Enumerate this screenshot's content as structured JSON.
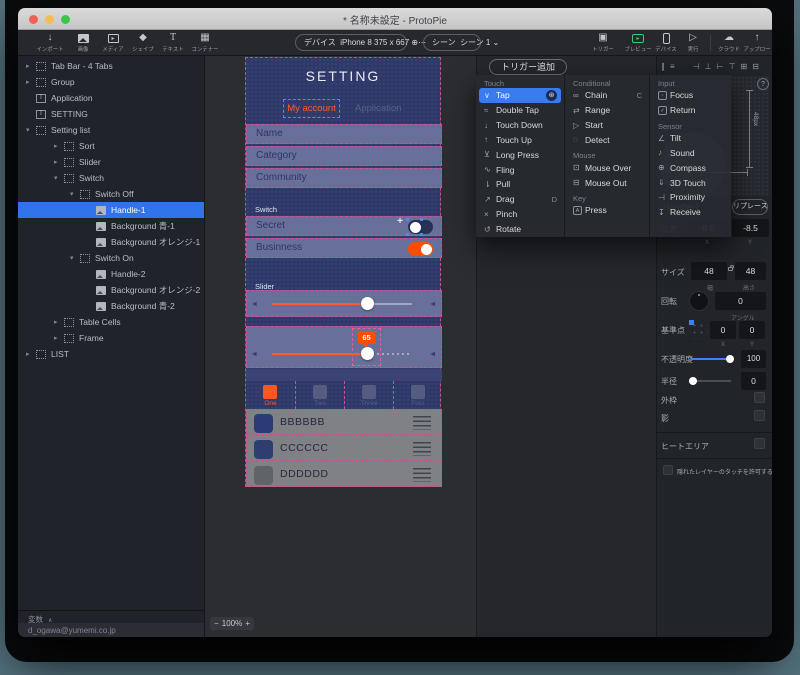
{
  "window": {
    "title": "* 名称未設定 - ProtoPie"
  },
  "toolbar": {
    "import": {
      "label": "インポート"
    },
    "insert_tools": [
      {
        "label": "画像"
      },
      {
        "label": "メディア"
      },
      {
        "label": "シェイプ"
      },
      {
        "label": "テキスト"
      },
      {
        "label": "コンテナー"
      }
    ],
    "device_selector": {
      "prefix": "デバイス",
      "value": "iPhone 8  375 x 667  ⊕⋯"
    },
    "scene_selector": {
      "prefix": "シーン",
      "value": "シーン 1  ⌄"
    },
    "right_tools": [
      {
        "label": "トリガー"
      },
      {
        "label": "プレビュー"
      },
      {
        "label": "デバイス"
      },
      {
        "label": "実行"
      },
      {
        "label": "クラウド"
      },
      {
        "label": "アップロード"
      }
    ]
  },
  "sidebar": {
    "layers": [
      {
        "label": "Tab Bar - 4 Tabs"
      },
      {
        "label": "Group"
      },
      {
        "label": "Application"
      },
      {
        "label": "SETTING"
      },
      {
        "label": "Setting list"
      },
      {
        "label": "Sort"
      },
      {
        "label": "Slider"
      },
      {
        "label": "Switch"
      },
      {
        "label": "Switch Off"
      },
      {
        "label": "Handle-1"
      },
      {
        "label": "Background 青-1"
      },
      {
        "label": "Background オレンジ-1"
      },
      {
        "label": "Switch On"
      },
      {
        "label": "Handle-2"
      },
      {
        "label": "Background オレンジ-2"
      },
      {
        "label": "Background 青-2"
      },
      {
        "label": "Table Cells"
      },
      {
        "label": "Frame"
      },
      {
        "label": "LIST"
      }
    ],
    "variables_label": "変数",
    "account_email": "d_ogawa@yumemi.co.jp"
  },
  "canvas": {
    "zoom_out": "−",
    "zoom_level": "100%",
    "zoom_in": "+"
  },
  "phone": {
    "title": "SETTING",
    "tabs": [
      {
        "label": "My account"
      },
      {
        "label": "Application"
      }
    ],
    "fields": [
      {
        "label": "Name"
      },
      {
        "label": "Category"
      },
      {
        "label": "Community"
      }
    ],
    "switch_section_label": "Switch",
    "switches": [
      {
        "label": "Secret",
        "state": "off"
      },
      {
        "label": "Businness",
        "state": "on"
      }
    ],
    "slider_section_label": "Slider",
    "slider_value": "65",
    "tabbar": [
      {
        "label": "One"
      },
      {
        "label": "Two"
      },
      {
        "label": "Three"
      },
      {
        "label": "Four"
      }
    ],
    "list": [
      {
        "label": "BBBBBB"
      },
      {
        "label": "CCCCCC"
      },
      {
        "label": "DDDDDD"
      }
    ]
  },
  "trigger_panel": {
    "add_button": "トリガー追加"
  },
  "trigger_menu": {
    "touch": {
      "header": "Touch",
      "items": [
        {
          "label": "Tap",
          "selected": true
        },
        {
          "label": "Double Tap"
        },
        {
          "label": "Touch Down"
        },
        {
          "label": "Touch Up"
        },
        {
          "label": "Long Press"
        },
        {
          "label": "Fling"
        },
        {
          "label": "Pull"
        },
        {
          "label": "Drag",
          "shortcut": "D"
        },
        {
          "label": "Pinch"
        },
        {
          "label": "Rotate"
        }
      ]
    },
    "conditional": {
      "header": "Conditional",
      "items": [
        {
          "label": "Chain",
          "shortcut": "C"
        },
        {
          "label": "Range"
        },
        {
          "label": "Start"
        },
        {
          "label": "Detect"
        }
      ]
    },
    "mouse": {
      "header": "Mouse",
      "items": [
        {
          "label": "Mouse Over"
        },
        {
          "label": "Mouse Out"
        }
      ]
    },
    "key": {
      "header": "Key",
      "items": [
        {
          "label": "Press"
        }
      ]
    },
    "input": {
      "header": "Input",
      "items": [
        {
          "label": "Focus"
        },
        {
          "label": "Return"
        }
      ]
    },
    "sensor": {
      "header": "Sensor",
      "items": [
        {
          "label": "Tilt"
        },
        {
          "label": "Sound"
        },
        {
          "label": "Compass"
        },
        {
          "label": "3D Touch"
        },
        {
          "label": "Proximity"
        },
        {
          "label": "Receive"
        }
      ]
    }
  },
  "properties": {
    "layer_name": "Handle-1",
    "replace_button": "リプレース",
    "size_measure": "48px",
    "help": "?",
    "position": {
      "label": "位置",
      "x": "-8.5",
      "y": "-8.5",
      "x_label": "X",
      "y_label": "Y"
    },
    "size": {
      "label": "サイズ",
      "width": "48",
      "height": "48",
      "width_label": "幅",
      "height_label": "高さ"
    },
    "rotation": {
      "label": "回転",
      "value": "0",
      "unit_label": "アングル"
    },
    "anchor": {
      "label": "基準点",
      "x": "0",
      "y": "0",
      "x_label": "X",
      "y_label": "Y"
    },
    "opacity": {
      "label": "不透明度",
      "value": "100"
    },
    "radius": {
      "label": "半径",
      "value": "0"
    },
    "border_label": "外枠",
    "shadow_label": "影",
    "heat_area_label": "ヒートエリア",
    "hidden_layer_touch_label": "隠れたレイヤーのタッチを許可する"
  },
  "icons": {
    "import": "↓",
    "upload": "↑",
    "run": "▷",
    "cloud": "☁",
    "trigger": "▣",
    "text_tool": "T",
    "tap": "∨",
    "double_tap": "≈",
    "touch_down": "↓",
    "touch_up": "↑",
    "long_press": "⊻",
    "fling": "∿",
    "pull": "⇂",
    "drag": "↗",
    "pinch": "×",
    "rotate": "↺",
    "chain": "∞",
    "range": "⇄",
    "start": "▷",
    "detect": "◌",
    "mouse_over": "⊡",
    "mouse_out": "⊟",
    "tilt": "∠",
    "sound": "♪",
    "compass": "⊕",
    "three_d_touch": "⇓",
    "proximity": "⊣",
    "receive": "↧",
    "badge": "⊛",
    "speaker": "◀"
  },
  "colors": {
    "accent_orange": "#ff5722",
    "accent_blue": "#3478f2",
    "selection_pink": "#d44f8f",
    "preview_green": "#2ecf6e"
  }
}
